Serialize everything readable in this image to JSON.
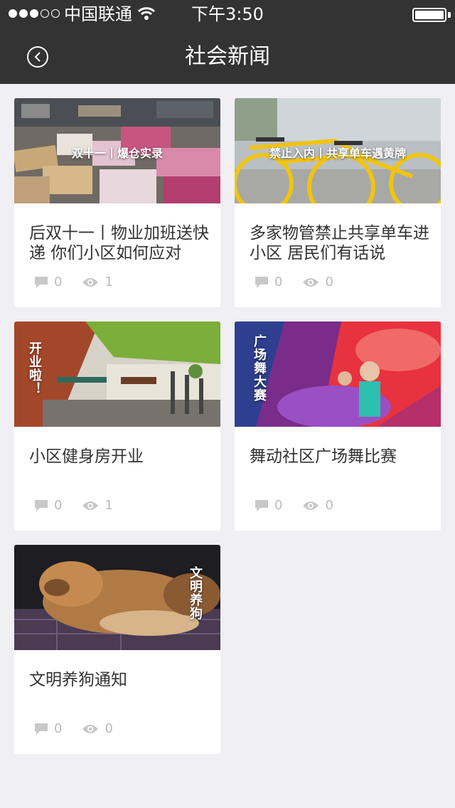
{
  "status_bar": {
    "carrier": "中国联通",
    "time": "下午3:50"
  },
  "nav": {
    "title": "社会新闻"
  },
  "articles": [
    {
      "image_caption": "双十一丨爆仓实录",
      "title": "后双十一丨物业加班送快递 你们小区如何应对",
      "comments": "0",
      "views": "1"
    },
    {
      "image_caption": "禁止入内丨共享单车遇黄牌",
      "title": "多家物管禁止共享单车进小区 居民们有话说",
      "comments": "0",
      "views": "0"
    },
    {
      "image_caption": "开业啦！",
      "title": "小区健身房开业",
      "comments": "0",
      "views": "1"
    },
    {
      "image_caption": "广场舞大赛",
      "title": "舞动社区广场舞比赛",
      "comments": "0",
      "views": "0"
    },
    {
      "image_caption": "文明养狗",
      "title": "文明养狗通知",
      "comments": "0",
      "views": "0"
    }
  ],
  "icons": {
    "back": "back-arrow-icon",
    "comment": "comment-bubble-icon",
    "views": "eye-icon",
    "wifi": "wifi-icon",
    "battery": "battery-icon"
  },
  "colors": {
    "bar_background": "#333333",
    "page_background": "#efeff4",
    "meta_gray": "#bbbbbb"
  }
}
